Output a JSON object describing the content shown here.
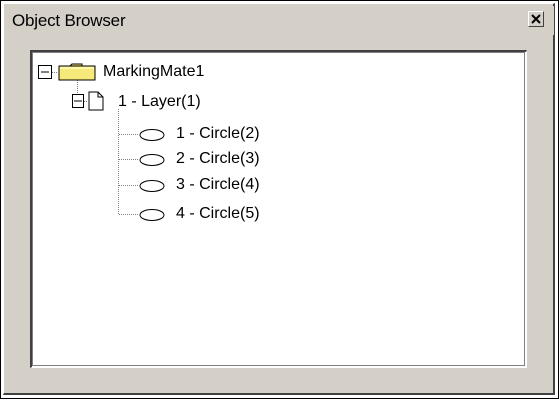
{
  "window": {
    "title": "Object Browser",
    "close_icon": "close-icon"
  },
  "tree": {
    "root": {
      "label": "MarkingMate1",
      "icon": "folder-icon",
      "expanded": true,
      "children": [
        {
          "label": "1 - Layer(1)",
          "icon": "layer-page-icon",
          "expanded": true,
          "children": [
            {
              "label": "1 - Circle(2)",
              "icon": "ellipse-icon"
            },
            {
              "label": "2 - Circle(3)",
              "icon": "ellipse-icon"
            },
            {
              "label": "3 - Circle(4)",
              "icon": "ellipse-icon"
            },
            {
              "label": "4 - Circle(5)",
              "icon": "ellipse-icon"
            }
          ]
        }
      ]
    }
  },
  "colors": {
    "face": "#d4d0c8",
    "folder_fill": "#f6e97a",
    "folder_edge": "#8a7a10"
  }
}
